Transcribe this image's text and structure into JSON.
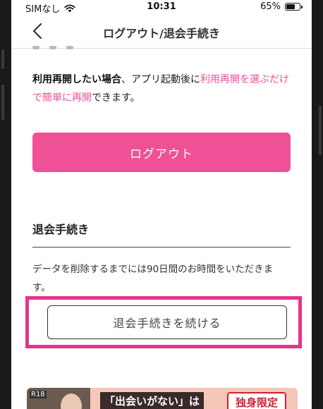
{
  "status_bar": {
    "carrier": "SIMなし",
    "time": "10:31",
    "battery_percent": "65%",
    "battery_level": 0.65
  },
  "nav": {
    "title": "ログアウト/退会手続き",
    "back_icon": "chevron-left-icon"
  },
  "restart": {
    "bold_lead": "利用再開したい場合",
    "text1": "、アプリ起動後に",
    "link1": "利用再開を選ぶ",
    "link2": "だけで簡単に再開",
    "text2": "できます。"
  },
  "logout_button_label": "ログアウト",
  "withdraw": {
    "section_title": "退会手続き",
    "description": "データを削除するまでには90日間のお時間をいただきます。",
    "button_label": "退会手続きを続ける",
    "highlight_color": "#e6338a"
  },
  "ad": {
    "tag": "R18",
    "headline": "「出会いがない」は",
    "badge": "独身限定"
  },
  "colors": {
    "accent": "#ef5196"
  }
}
